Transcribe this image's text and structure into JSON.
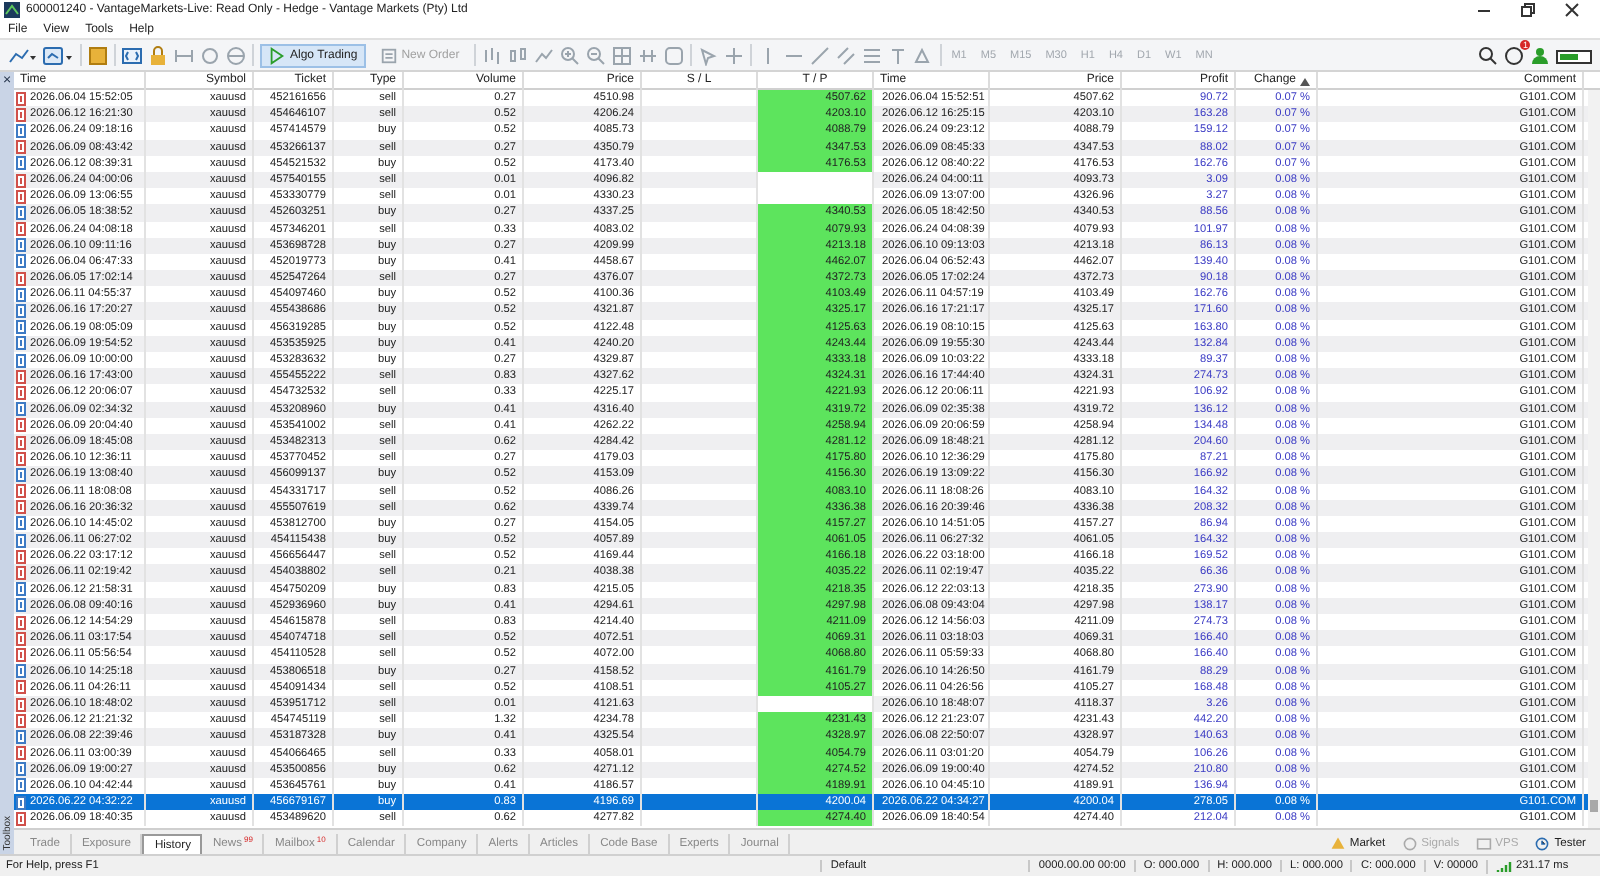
{
  "window": {
    "title": "600001240 - VantageMarkets-Live: Read Only - Hedge - Vantage Markets (Pty) Ltd"
  },
  "menu": [
    "File",
    "View",
    "Tools",
    "Help"
  ],
  "toolbar": {
    "buttons": [
      {
        "label": "Algo Trading",
        "selected": true,
        "disabled": false
      },
      {
        "label": "New Order",
        "selected": false,
        "disabled": true
      }
    ],
    "timeframes": [
      {
        "label": "M1",
        "disabled": true
      },
      {
        "label": "M5",
        "disabled": true
      },
      {
        "label": "M15",
        "disabled": true
      },
      {
        "label": "M30",
        "disabled": true
      },
      {
        "label": "H1",
        "disabled": true
      },
      {
        "label": "H4",
        "disabled": true
      },
      {
        "label": "D1",
        "disabled": true
      },
      {
        "label": "W1",
        "disabled": true
      },
      {
        "label": "MN",
        "disabled": true
      }
    ],
    "notification_badge": "1"
  },
  "toolbox": {
    "label": "Toolbox",
    "close": "×"
  },
  "table": {
    "columns": [
      {
        "label": "Time",
        "sorted": false
      },
      {
        "label": "Symbol",
        "sorted": false
      },
      {
        "label": "Ticket",
        "sorted": false
      },
      {
        "label": "Type",
        "sorted": false
      },
      {
        "label": "Volume",
        "sorted": false
      },
      {
        "label": "Price",
        "sorted": false
      },
      {
        "label": "S / L",
        "sorted": false
      },
      {
        "label": "T / P",
        "sorted": false
      },
      {
        "label": "Time",
        "sorted": false
      },
      {
        "label": "Price",
        "sorted": false
      },
      {
        "label": "Profit",
        "sorted": false
      },
      {
        "label": "Change",
        "sorted": true
      },
      {
        "label": "Comment",
        "sorted": false
      }
    ],
    "rows": [
      {
        "kind": "sell",
        "time": "2026.06.04 15:52:05",
        "symbol": "xauusd",
        "ticket": "452161656",
        "type": "sell",
        "volume": "0.27",
        "price": "4510.98",
        "tp": "4507.62",
        "close_time": "2026.06.04 15:52:51",
        "close_price": "4507.62",
        "profit": "90.72",
        "change": "0.07 %",
        "comment": "G101.COM",
        "selected": false
      },
      {
        "kind": "sell",
        "time": "2026.06.12 16:21:30",
        "symbol": "xauusd",
        "ticket": "454646107",
        "type": "sell",
        "volume": "0.52",
        "price": "4206.24",
        "tp": "4203.10",
        "close_time": "2026.06.12 16:25:15",
        "close_price": "4203.10",
        "profit": "163.28",
        "change": "0.07 %",
        "comment": "G101.COM",
        "selected": false
      },
      {
        "kind": "buy",
        "time": "2026.06.24 09:18:16",
        "symbol": "xauusd",
        "ticket": "457414579",
        "type": "buy",
        "volume": "0.52",
        "price": "4085.73",
        "tp": "4088.79",
        "close_time": "2026.06.24 09:23:12",
        "close_price": "4088.79",
        "profit": "159.12",
        "change": "0.07 %",
        "comment": "G101.COM",
        "selected": false
      },
      {
        "kind": "sell",
        "time": "2026.06.09 08:43:42",
        "symbol": "xauusd",
        "ticket": "453266137",
        "type": "sell",
        "volume": "0.27",
        "price": "4350.79",
        "tp": "4347.53",
        "close_time": "2026.06.09 08:45:33",
        "close_price": "4347.53",
        "profit": "88.02",
        "change": "0.07 %",
        "comment": "G101.COM",
        "selected": false
      },
      {
        "kind": "buy",
        "time": "2026.06.12 08:39:31",
        "symbol": "xauusd",
        "ticket": "454521532",
        "type": "buy",
        "volume": "0.52",
        "price": "4173.40",
        "tp": "4176.53",
        "close_time": "2026.06.12 08:40:22",
        "close_price": "4176.53",
        "profit": "162.76",
        "change": "0.07 %",
        "comment": "G101.COM",
        "selected": false
      },
      {
        "kind": "sell",
        "time": "2026.06.24 04:00:06",
        "symbol": "xauusd",
        "ticket": "457540155",
        "type": "sell",
        "volume": "0.01",
        "price": "4096.82",
        "close_time": "2026.06.24 04:00:11",
        "close_price": "4093.73",
        "profit": "3.09",
        "change": "0.08 %",
        "comment": "G101.COM",
        "selected": false
      },
      {
        "kind": "sell",
        "time": "2026.06.09 13:06:55",
        "symbol": "xauusd",
        "ticket": "453330779",
        "type": "sell",
        "volume": "0.01",
        "price": "4330.23",
        "close_time": "2026.06.09 13:07:00",
        "close_price": "4326.96",
        "profit": "3.27",
        "change": "0.08 %",
        "comment": "G101.COM",
        "selected": false
      },
      {
        "kind": "buy",
        "time": "2026.06.05 18:38:52",
        "symbol": "xauusd",
        "ticket": "452603251",
        "type": "buy",
        "volume": "0.27",
        "price": "4337.25",
        "tp": "4340.53",
        "close_time": "2026.06.05 18:42:50",
        "close_price": "4340.53",
        "profit": "88.56",
        "change": "0.08 %",
        "comment": "G101.COM",
        "selected": false
      },
      {
        "kind": "sell",
        "time": "2026.06.24 04:08:18",
        "symbol": "xauusd",
        "ticket": "457346201",
        "type": "sell",
        "volume": "0.33",
        "price": "4083.02",
        "tp": "4079.93",
        "close_time": "2026.06.24 04:08:39",
        "close_price": "4079.93",
        "profit": "101.97",
        "change": "0.08 %",
        "comment": "G101.COM",
        "selected": false
      },
      {
        "kind": "buy",
        "time": "2026.06.10 09:11:16",
        "symbol": "xauusd",
        "ticket": "453698728",
        "type": "buy",
        "volume": "0.27",
        "price": "4209.99",
        "tp": "4213.18",
        "close_time": "2026.06.10 09:13:03",
        "close_price": "4213.18",
        "profit": "86.13",
        "change": "0.08 %",
        "comment": "G101.COM",
        "selected": false
      },
      {
        "kind": "buy",
        "time": "2026.06.04 06:47:33",
        "symbol": "xauusd",
        "ticket": "452019773",
        "type": "buy",
        "volume": "0.41",
        "price": "4458.67",
        "tp": "4462.07",
        "close_time": "2026.06.04 06:52:43",
        "close_price": "4462.07",
        "profit": "139.40",
        "change": "0.08 %",
        "comment": "G101.COM",
        "selected": false
      },
      {
        "kind": "sell",
        "time": "2026.06.05 17:02:14",
        "symbol": "xauusd",
        "ticket": "452547264",
        "type": "sell",
        "volume": "0.27",
        "price": "4376.07",
        "tp": "4372.73",
        "close_time": "2026.06.05 17:02:24",
        "close_price": "4372.73",
        "profit": "90.18",
        "change": "0.08 %",
        "comment": "G101.COM",
        "selected": false
      },
      {
        "kind": "buy",
        "time": "2026.06.11 04:55:37",
        "symbol": "xauusd",
        "ticket": "454097460",
        "type": "buy",
        "volume": "0.52",
        "price": "4100.36",
        "tp": "4103.49",
        "close_time": "2026.06.11 04:57:19",
        "close_price": "4103.49",
        "profit": "162.76",
        "change": "0.08 %",
        "comment": "G101.COM",
        "selected": false
      },
      {
        "kind": "buy",
        "time": "2026.06.16 17:20:27",
        "symbol": "xauusd",
        "ticket": "455438686",
        "type": "buy",
        "volume": "0.52",
        "price": "4321.87",
        "tp": "4325.17",
        "close_time": "2026.06.16 17:21:17",
        "close_price": "4325.17",
        "profit": "171.60",
        "change": "0.08 %",
        "comment": "G101.COM",
        "selected": false
      },
      {
        "kind": "buy",
        "time": "2026.06.19 08:05:09",
        "symbol": "xauusd",
        "ticket": "456319285",
        "type": "buy",
        "volume": "0.52",
        "price": "4122.48",
        "tp": "4125.63",
        "close_time": "2026.06.19 08:10:15",
        "close_price": "4125.63",
        "profit": "163.80",
        "change": "0.08 %",
        "comment": "G101.COM",
        "selected": false
      },
      {
        "kind": "buy",
        "time": "2026.06.09 19:54:52",
        "symbol": "xauusd",
        "ticket": "453535925",
        "type": "buy",
        "volume": "0.41",
        "price": "4240.20",
        "tp": "4243.44",
        "close_time": "2026.06.09 19:55:30",
        "close_price": "4243.44",
        "profit": "132.84",
        "change": "0.08 %",
        "comment": "G101.COM",
        "selected": false
      },
      {
        "kind": "buy",
        "time": "2026.06.09 10:00:00",
        "symbol": "xauusd",
        "ticket": "453283632",
        "type": "buy",
        "volume": "0.27",
        "price": "4329.87",
        "tp": "4333.18",
        "close_time": "2026.06.09 10:03:22",
        "close_price": "4333.18",
        "profit": "89.37",
        "change": "0.08 %",
        "comment": "G101.COM",
        "selected": false
      },
      {
        "kind": "sell",
        "time": "2026.06.16 17:43:00",
        "symbol": "xauusd",
        "ticket": "455455222",
        "type": "sell",
        "volume": "0.83",
        "price": "4327.62",
        "tp": "4324.31",
        "close_time": "2026.06.16 17:44:40",
        "close_price": "4324.31",
        "profit": "274.73",
        "change": "0.08 %",
        "comment": "G101.COM",
        "selected": false
      },
      {
        "kind": "sell",
        "time": "2026.06.12 20:06:07",
        "symbol": "xauusd",
        "ticket": "454732532",
        "type": "sell",
        "volume": "0.33",
        "price": "4225.17",
        "tp": "4221.93",
        "close_time": "2026.06.12 20:06:11",
        "close_price": "4221.93",
        "profit": "106.92",
        "change": "0.08 %",
        "comment": "G101.COM",
        "selected": false
      },
      {
        "kind": "buy",
        "time": "2026.06.09 02:34:32",
        "symbol": "xauusd",
        "ticket": "453208960",
        "type": "buy",
        "volume": "0.41",
        "price": "4316.40",
        "tp": "4319.72",
        "close_time": "2026.06.09 02:35:38",
        "close_price": "4319.72",
        "profit": "136.12",
        "change": "0.08 %",
        "comment": "G101.COM",
        "selected": false
      },
      {
        "kind": "sell",
        "time": "2026.06.09 20:04:40",
        "symbol": "xauusd",
        "ticket": "453541002",
        "type": "sell",
        "volume": "0.41",
        "price": "4262.22",
        "tp": "4258.94",
        "close_time": "2026.06.09 20:06:59",
        "close_price": "4258.94",
        "profit": "134.48",
        "change": "0.08 %",
        "comment": "G101.COM",
        "selected": false
      },
      {
        "kind": "sell",
        "time": "2026.06.09 18:45:08",
        "symbol": "xauusd",
        "ticket": "453482313",
        "type": "sell",
        "volume": "0.62",
        "price": "4284.42",
        "tp": "4281.12",
        "close_time": "2026.06.09 18:48:21",
        "close_price": "4281.12",
        "profit": "204.60",
        "change": "0.08 %",
        "comment": "G101.COM",
        "selected": false
      },
      {
        "kind": "sell",
        "time": "2026.06.10 12:36:11",
        "symbol": "xauusd",
        "ticket": "453770452",
        "type": "sell",
        "volume": "0.27",
        "price": "4179.03",
        "tp": "4175.80",
        "close_time": "2026.06.10 12:36:29",
        "close_price": "4175.80",
        "profit": "87.21",
        "change": "0.08 %",
        "comment": "G101.COM",
        "selected": false
      },
      {
        "kind": "buy",
        "time": "2026.06.19 13:08:40",
        "symbol": "xauusd",
        "ticket": "456099137",
        "type": "buy",
        "volume": "0.52",
        "price": "4153.09",
        "tp": "4156.30",
        "close_time": "2026.06.19 13:09:22",
        "close_price": "4156.30",
        "profit": "166.92",
        "change": "0.08 %",
        "comment": "G101.COM",
        "selected": false
      },
      {
        "kind": "sell",
        "time": "2026.06.11 18:08:08",
        "symbol": "xauusd",
        "ticket": "454331717",
        "type": "sell",
        "volume": "0.52",
        "price": "4086.26",
        "tp": "4083.10",
        "close_time": "2026.06.11 18:08:26",
        "close_price": "4083.10",
        "profit": "164.32",
        "change": "0.08 %",
        "comment": "G101.COM",
        "selected": false
      },
      {
        "kind": "sell",
        "time": "2026.06.16 20:36:32",
        "symbol": "xauusd",
        "ticket": "455507619",
        "type": "sell",
        "volume": "0.62",
        "price": "4339.74",
        "tp": "4336.38",
        "close_time": "2026.06.16 20:39:46",
        "close_price": "4336.38",
        "profit": "208.32",
        "change": "0.08 %",
        "comment": "G101.COM",
        "selected": false
      },
      {
        "kind": "buy",
        "time": "2026.06.10 14:45:02",
        "symbol": "xauusd",
        "ticket": "453812700",
        "type": "buy",
        "volume": "0.27",
        "price": "4154.05",
        "tp": "4157.27",
        "close_time": "2026.06.10 14:51:05",
        "close_price": "4157.27",
        "profit": "86.94",
        "change": "0.08 %",
        "comment": "G101.COM",
        "selected": false
      },
      {
        "kind": "buy",
        "time": "2026.06.11 06:27:02",
        "symbol": "xauusd",
        "ticket": "454115438",
        "type": "buy",
        "volume": "0.52",
        "price": "4057.89",
        "tp": "4061.05",
        "close_time": "2026.06.11 06:27:32",
        "close_price": "4061.05",
        "profit": "164.32",
        "change": "0.08 %",
        "comment": "G101.COM",
        "selected": false
      },
      {
        "kind": "sell",
        "time": "2026.06.22 03:17:12",
        "symbol": "xauusd",
        "ticket": "456656447",
        "type": "sell",
        "volume": "0.52",
        "price": "4169.44",
        "tp": "4166.18",
        "close_time": "2026.06.22 03:18:00",
        "close_price": "4166.18",
        "profit": "169.52",
        "change": "0.08 %",
        "comment": "G101.COM",
        "selected": false
      },
      {
        "kind": "sell",
        "time": "2026.06.11 02:19:42",
        "symbol": "xauusd",
        "ticket": "454038802",
        "type": "sell",
        "volume": "0.21",
        "price": "4038.38",
        "tp": "4035.22",
        "close_time": "2026.06.11 02:19:47",
        "close_price": "4035.22",
        "profit": "66.36",
        "change": "0.08 %",
        "comment": "G101.COM",
        "selected": false
      },
      {
        "kind": "buy",
        "time": "2026.06.12 21:58:31",
        "symbol": "xauusd",
        "ticket": "454750209",
        "type": "buy",
        "volume": "0.83",
        "price": "4215.05",
        "tp": "4218.35",
        "close_time": "2026.06.12 22:03:13",
        "close_price": "4218.35",
        "profit": "273.90",
        "change": "0.08 %",
        "comment": "G101.COM",
        "selected": false
      },
      {
        "kind": "buy",
        "time": "2026.06.08 09:40:16",
        "symbol": "xauusd",
        "ticket": "452936960",
        "type": "buy",
        "volume": "0.41",
        "price": "4294.61",
        "tp": "4297.98",
        "close_time": "2026.06.08 09:43:04",
        "close_price": "4297.98",
        "profit": "138.17",
        "change": "0.08 %",
        "comment": "G101.COM",
        "selected": false
      },
      {
        "kind": "sell",
        "time": "2026.06.12 14:54:29",
        "symbol": "xauusd",
        "ticket": "454615878",
        "type": "sell",
        "volume": "0.83",
        "price": "4214.40",
        "tp": "4211.09",
        "close_time": "2026.06.12 14:56:03",
        "close_price": "4211.09",
        "profit": "274.73",
        "change": "0.08 %",
        "comment": "G101.COM",
        "selected": false
      },
      {
        "kind": "sell",
        "time": "2026.06.11 03:17:54",
        "symbol": "xauusd",
        "ticket": "454074718",
        "type": "sell",
        "volume": "0.52",
        "price": "4072.51",
        "tp": "4069.31",
        "close_time": "2026.06.11 03:18:03",
        "close_price": "4069.31",
        "profit": "166.40",
        "change": "0.08 %",
        "comment": "G101.COM",
        "selected": false
      },
      {
        "kind": "sell",
        "time": "2026.06.11 05:56:54",
        "symbol": "xauusd",
        "ticket": "454110528",
        "type": "sell",
        "volume": "0.52",
        "price": "4072.00",
        "tp": "4068.80",
        "close_time": "2026.06.11 05:59:33",
        "close_price": "4068.80",
        "profit": "166.40",
        "change": "0.08 %",
        "comment": "G101.COM",
        "selected": false
      },
      {
        "kind": "buy",
        "time": "2026.06.10 14:25:18",
        "symbol": "xauusd",
        "ticket": "453806518",
        "type": "buy",
        "volume": "0.27",
        "price": "4158.52",
        "tp": "4161.79",
        "close_time": "2026.06.10 14:26:50",
        "close_price": "4161.79",
        "profit": "88.29",
        "change": "0.08 %",
        "comment": "G101.COM",
        "selected": false
      },
      {
        "kind": "sell",
        "time": "2026.06.11 04:26:11",
        "symbol": "xauusd",
        "ticket": "454091434",
        "type": "sell",
        "volume": "0.52",
        "price": "4108.51",
        "tp": "4105.27",
        "close_time": "2026.06.11 04:26:56",
        "close_price": "4105.27",
        "profit": "168.48",
        "change": "0.08 %",
        "comment": "G101.COM",
        "selected": false
      },
      {
        "kind": "sell",
        "time": "2026.06.10 18:48:02",
        "symbol": "xauusd",
        "ticket": "453951712",
        "type": "sell",
        "volume": "0.01",
        "price": "4121.63",
        "close_time": "2026.06.10 18:48:07",
        "close_price": "4118.37",
        "profit": "3.26",
        "change": "0.08 %",
        "comment": "G101.COM",
        "selected": false
      },
      {
        "kind": "sell",
        "time": "2026.06.12 21:21:32",
        "symbol": "xauusd",
        "ticket": "454745119",
        "type": "sell",
        "volume": "1.32",
        "price": "4234.78",
        "tp": "4231.43",
        "close_time": "2026.06.12 21:23:07",
        "close_price": "4231.43",
        "profit": "442.20",
        "change": "0.08 %",
        "comment": "G101.COM",
        "selected": false
      },
      {
        "kind": "buy",
        "time": "2026.06.08 22:39:46",
        "symbol": "xauusd",
        "ticket": "453187328",
        "type": "buy",
        "volume": "0.41",
        "price": "4325.54",
        "tp": "4328.97",
        "close_time": "2026.06.08 22:50:07",
        "close_price": "4328.97",
        "profit": "140.63",
        "change": "0.08 %",
        "comment": "G101.COM",
        "selected": false
      },
      {
        "kind": "sell",
        "time": "2026.06.11 03:00:39",
        "symbol": "xauusd",
        "ticket": "454066465",
        "type": "sell",
        "volume": "0.33",
        "price": "4058.01",
        "tp": "4054.79",
        "close_time": "2026.06.11 03:01:20",
        "close_price": "4054.79",
        "profit": "106.26",
        "change": "0.08 %",
        "comment": "G101.COM",
        "selected": false
      },
      {
        "kind": "buy",
        "time": "2026.06.09 19:00:27",
        "symbol": "xauusd",
        "ticket": "453500856",
        "type": "buy",
        "volume": "0.62",
        "price": "4271.12",
        "tp": "4274.52",
        "close_time": "2026.06.09 19:00:40",
        "close_price": "4274.52",
        "profit": "210.80",
        "change": "0.08 %",
        "comment": "G101.COM",
        "selected": false
      },
      {
        "kind": "buy",
        "time": "2026.06.10 04:42:44",
        "symbol": "xauusd",
        "ticket": "453645761",
        "type": "buy",
        "volume": "0.41",
        "price": "4186.57",
        "tp": "4189.91",
        "close_time": "2026.06.10 04:45:10",
        "close_price": "4189.91",
        "profit": "136.94",
        "change": "0.08 %",
        "comment": "G101.COM",
        "selected": false
      },
      {
        "kind": "buy",
        "time": "2026.06.22 04:32:22",
        "symbol": "xauusd",
        "ticket": "456679167",
        "type": "buy",
        "volume": "0.83",
        "price": "4196.69",
        "tp": "4200.04",
        "close_time": "2026.06.22 04:34:27",
        "close_price": "4200.04",
        "profit": "278.05",
        "change": "0.08 %",
        "comment": "G101.COM",
        "selected": true
      },
      {
        "kind": "sell",
        "time": "2026.06.09 18:40:35",
        "symbol": "xauusd",
        "ticket": "453489620",
        "type": "sell",
        "volume": "0.62",
        "price": "4277.82",
        "tp": "4274.40",
        "close_time": "2026.06.09 18:40:54",
        "close_price": "4274.40",
        "profit": "212.04",
        "change": "0.08 %",
        "comment": "G101.COM",
        "selected": false
      }
    ]
  },
  "tabs": [
    {
      "label": "Trade",
      "selected": false
    },
    {
      "label": "Exposure",
      "selected": false
    },
    {
      "label": "History",
      "selected": true
    },
    {
      "label": "News",
      "badge": "99",
      "selected": false
    },
    {
      "label": "Mailbox",
      "badge": "10",
      "selected": false
    },
    {
      "label": "Calendar",
      "selected": false
    },
    {
      "label": "Company",
      "selected": false
    },
    {
      "label": "Alerts",
      "selected": false
    },
    {
      "label": "Articles",
      "selected": false
    },
    {
      "label": "Code Base",
      "selected": false
    },
    {
      "label": "Experts",
      "selected": false
    },
    {
      "label": "Journal",
      "selected": false
    }
  ],
  "side_tabs": [
    {
      "label": "Market",
      "disabled": false
    },
    {
      "label": "Signals",
      "disabled": true
    },
    {
      "label": "VPS",
      "disabled": true
    },
    {
      "label": "Tester",
      "disabled": false
    }
  ],
  "status_bar": {
    "help": "For Help, press F1",
    "profile": "Default",
    "fields": [
      "0000.00.00 00:00",
      "O: 000.000",
      "H: 000.000",
      "L: 000.000",
      "C: 000.000",
      "V: 00000"
    ],
    "ping": "231.17 ms"
  }
}
